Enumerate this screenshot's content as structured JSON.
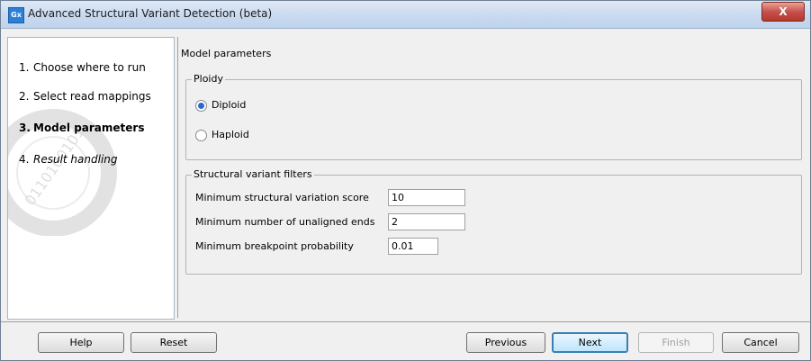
{
  "window": {
    "app_icon": "Gx",
    "title": "Advanced Structural Variant Detection (beta)",
    "close_glyph": "X"
  },
  "sidebar": {
    "steps": [
      {
        "num": "1.",
        "label": "Choose where to run"
      },
      {
        "num": "2.",
        "label": "Select read mappings"
      },
      {
        "num": "3.",
        "label": "Model parameters"
      },
      {
        "num": "4.",
        "label": "Result handling"
      }
    ],
    "watermark_text": "0110100101"
  },
  "main": {
    "heading": "Model parameters",
    "ploidy": {
      "label": "Ploidy",
      "options": [
        {
          "label": "Diploid",
          "checked": true
        },
        {
          "label": "Haploid",
          "checked": false
        }
      ]
    },
    "filters": {
      "label": "Structural variant filters",
      "fields": [
        {
          "label": "Minimum structural variation score",
          "value": "10"
        },
        {
          "label": "Minimum number of unaligned ends",
          "value": "2"
        },
        {
          "label": "Minimum breakpoint probability",
          "value": "0.01"
        }
      ]
    }
  },
  "buttons": {
    "help": "Help",
    "reset": "Reset",
    "previous": "Previous",
    "next": "Next",
    "finish": "Finish",
    "cancel": "Cancel"
  }
}
